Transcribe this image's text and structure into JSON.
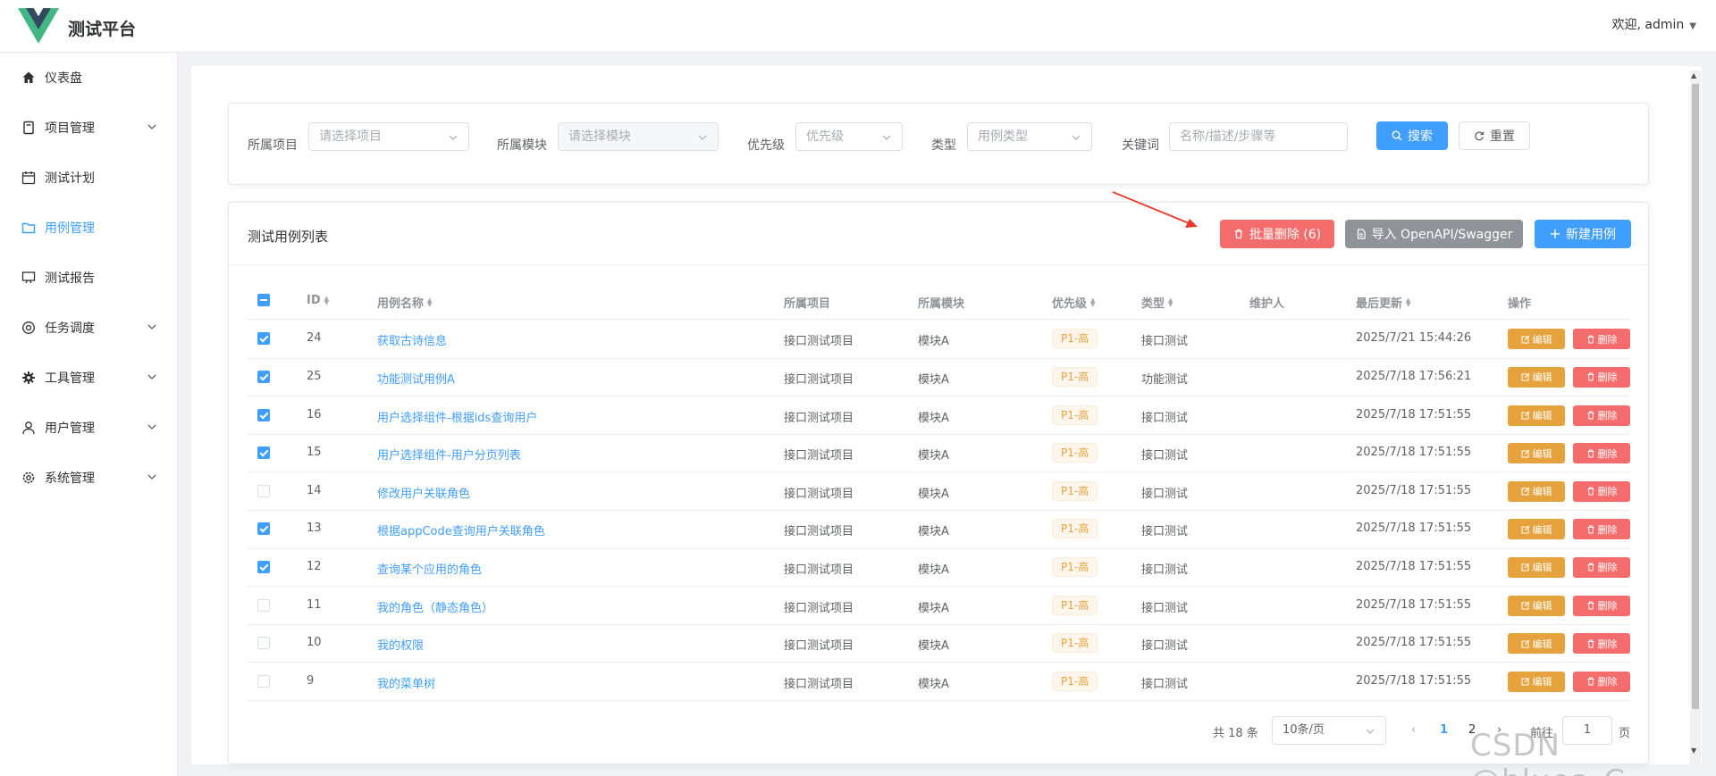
{
  "app": {
    "title": "测试平台",
    "user_greeting": "欢迎, admin"
  },
  "sidebar": {
    "items": [
      {
        "label": "仪表盘",
        "icon": "home-icon"
      },
      {
        "label": "项目管理",
        "icon": "book-icon"
      },
      {
        "label": "测试计划",
        "icon": "calendar-icon"
      },
      {
        "label": "用例管理",
        "icon": "folder-icon"
      },
      {
        "label": "测试报告",
        "icon": "report-icon"
      },
      {
        "label": "任务调度",
        "icon": "clock-icon"
      },
      {
        "label": "工具管理",
        "icon": "tool-icon"
      },
      {
        "label": "用户管理",
        "icon": "user-icon"
      },
      {
        "label": "系统管理",
        "icon": "settings-icon"
      }
    ]
  },
  "filters": {
    "project_label": "所属项目",
    "project_placeholder": "请选择项目",
    "module_label": "所属模块",
    "module_placeholder": "请选择模块",
    "priority_label": "优先级",
    "priority_placeholder": "优先级",
    "type_label": "类型",
    "type_placeholder": "用例类型",
    "keyword_label": "关键词",
    "keyword_placeholder": "名称/描述/步骤等",
    "search_button": "搜索",
    "reset_button": "重置"
  },
  "list": {
    "title": "测试用例列表",
    "batch_delete": "批量删除 (6)",
    "import_button": "导入 OpenAPI/Swagger",
    "new_button": "新建用例",
    "columns": [
      "ID",
      "用例名称",
      "所属项目",
      "所属模块",
      "优先级",
      "类型",
      "维护人",
      "最后更新",
      "操作"
    ],
    "rows": [
      {
        "checked": true,
        "id": "24",
        "name": "获取古诗信息",
        "project": "接口测试项目",
        "module": "模块A",
        "priority": "P1-高",
        "type": "接口测试",
        "maintainer": "",
        "updated": "2025/7/21 15:44:26"
      },
      {
        "checked": true,
        "id": "25",
        "name": "功能测试用例A",
        "project": "接口测试项目",
        "module": "模块A",
        "priority": "P1-高",
        "type": "功能测试",
        "maintainer": "",
        "updated": "2025/7/18 17:56:21"
      },
      {
        "checked": true,
        "id": "16",
        "name": "用户选择组件-根据ids查询用户",
        "project": "接口测试项目",
        "module": "模块A",
        "priority": "P1-高",
        "type": "接口测试",
        "maintainer": "",
        "updated": "2025/7/18 17:51:55"
      },
      {
        "checked": true,
        "id": "15",
        "name": "用户选择组件-用户分页列表",
        "project": "接口测试项目",
        "module": "模块A",
        "priority": "P1-高",
        "type": "接口测试",
        "maintainer": "",
        "updated": "2025/7/18 17:51:55"
      },
      {
        "checked": false,
        "id": "14",
        "name": "修改用户关联角色",
        "project": "接口测试项目",
        "module": "模块A",
        "priority": "P1-高",
        "type": "接口测试",
        "maintainer": "",
        "updated": "2025/7/18 17:51:55"
      },
      {
        "checked": true,
        "id": "13",
        "name": "根据appCode查询用户关联角色",
        "project": "接口测试项目",
        "module": "模块A",
        "priority": "P1-高",
        "type": "接口测试",
        "maintainer": "",
        "updated": "2025/7/18 17:51:55"
      },
      {
        "checked": true,
        "id": "12",
        "name": "查询某个应用的角色",
        "project": "接口测试项目",
        "module": "模块A",
        "priority": "P1-高",
        "type": "接口测试",
        "maintainer": "",
        "updated": "2025/7/18 17:51:55"
      },
      {
        "checked": false,
        "id": "11",
        "name": "我的角色（静态角色）",
        "project": "接口测试项目",
        "module": "模块A",
        "priority": "P1-高",
        "type": "接口测试",
        "maintainer": "",
        "updated": "2025/7/18 17:51:55"
      },
      {
        "checked": false,
        "id": "10",
        "name": "我的权限",
        "project": "接口测试项目",
        "module": "模块A",
        "priority": "P1-高",
        "type": "接口测试",
        "maintainer": "",
        "updated": "2025/7/18 17:51:55"
      },
      {
        "checked": false,
        "id": "9",
        "name": "我的菜单树",
        "project": "接口测试项目",
        "module": "模块A",
        "priority": "P1-高",
        "type": "接口测试",
        "maintainer": "",
        "updated": "2025/7/18 17:51:55"
      }
    ],
    "edit_label": "编辑",
    "delete_label": "删除"
  },
  "pagination": {
    "total": "共 18 条",
    "page_size": "10条/页",
    "pages": [
      "1",
      "2"
    ],
    "current": "1",
    "goto_label": "前往",
    "goto_value": "1",
    "page_suffix": "页"
  },
  "watermark": "CSDN @blues_C",
  "colors": {
    "primary": "#409eff",
    "danger": "#f56c6c",
    "warning": "#e6a23c",
    "info": "#909399",
    "annotation_arrow": "#e8392b"
  }
}
